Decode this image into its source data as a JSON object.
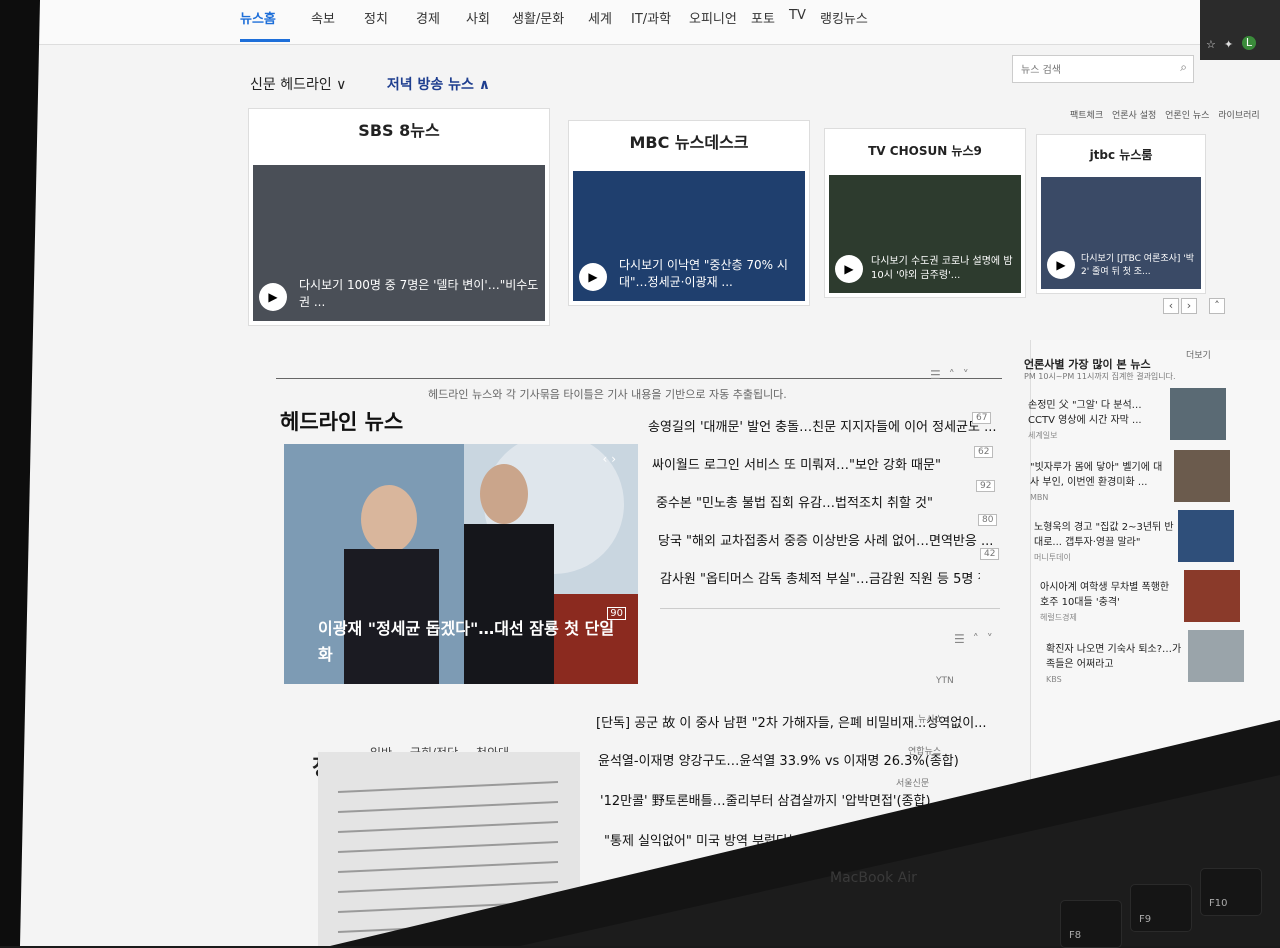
{
  "nav": {
    "items": [
      "뉴스홈",
      "속보",
      "정치",
      "경제",
      "사회",
      "생활/문화",
      "세계",
      "IT/과학",
      "오피니언",
      "포토",
      "TV",
      "랭킹뉴스"
    ]
  },
  "search": {
    "placeholder": "뉴스 검색"
  },
  "subtabs": {
    "newspaper": "신문 헤드라인 ∨",
    "evening": "저녁 방송 뉴스 ∧"
  },
  "util": [
    "팩트체크",
    "언론사 설정",
    "언론인 뉴스",
    "라이브러리"
  ],
  "broadcast": [
    {
      "logo": "SBS 8뉴스",
      "caption": "다시보기 100명 중 7명은 '델타 변이'…\"비수도권 ...",
      "color": "#4a4f57"
    },
    {
      "logo": "MBC 뉴스데스크",
      "caption": "다시보기 이낙연 \"중산층 70% 시대\"…정세균·이광재 ...",
      "color": "#1f3f6e"
    },
    {
      "logo": "TV CHOSUN 뉴스9",
      "caption": "다시보기 수도권 코로나 설명에 밤10시 '야외 금주령'...",
      "color": "#2d3b2e"
    },
    {
      "logo": "jtbc 뉴스룸",
      "caption": "다시보기 [JTBC 여론조사] '박2' 줄여 뒤 첫 조...",
      "color": "#3a4a66"
    }
  ],
  "headline": {
    "title": "헤드라인 뉴스",
    "note": "헤드라인 뉴스와 각 기사묶음 타이틀은 기사 내용을 기반으로 자동 추출됩니다.",
    "main_caption": "이광재 \"정세균 돕겠다\"…대선 잠룡 첫 단일화",
    "main_count": "90",
    "items": [
      {
        "text": "송영길의 '대깨문' 발언 충돌…친문 지지자들에 이어 정세균도 ...",
        "count": "67"
      },
      {
        "text": "싸이월드 로그인 서비스 또 미뤄져…\"보안 강화 때문\"",
        "count": "62"
      },
      {
        "text": "중수본 \"민노총 불법 집회 유감…법적조치 취할 것\"",
        "count": "92"
      },
      {
        "text": "당국 \"해외 교차접종서 중증 이상반응 사례 없어…면역반응 ...",
        "count": "80"
      },
      {
        "text": "감사원 \"옵티머스 감독 총체적 부실\"…금감원 직원 등 5명 징...",
        "count": "42"
      }
    ]
  },
  "side": {
    "title": "언론사별 가장 많이 본 뉴스",
    "sub": "PM 10시~PM 11시까지 집계한 결과입니다.",
    "more": "더보기",
    "items": [
      {
        "text": "손정민 父 \"그알' 다 분석… CCTV 영상에 시간 자막 ...",
        "src": "세계일보"
      },
      {
        "text": "\"빗자루가 몸에 닿아\" 벨기에 대사 부인, 이번엔 환경미화 ...",
        "src": "MBN"
      },
      {
        "text": "노형욱의 경고 \"집값 2~3년뒤 반대로... 갭투자·영끌 말라\"",
        "src": "머니투데이"
      },
      {
        "text": "아시아계 여학생 무차별 폭행한 호주 10대들 '충격'",
        "src": "헤럴드경제"
      },
      {
        "text": "확진자 나오면 기숙사 퇴소?…가족들은 어쩌라고",
        "src": "KBS"
      }
    ]
  },
  "politics": {
    "title": "정치",
    "tabs": [
      "일반",
      "국회/정당",
      "청와대"
    ],
    "items": [
      {
        "text": "[단독] 공군 故 이 중사 남편 \"2차 가해자들, 은폐 비밀비재...성역없이...",
        "src": "YTN"
      },
      {
        "text": "윤석열-이재명 양강구도…윤석열 33.9% vs 이재명 26.3%(종합)",
        "src": "뉴시스"
      },
      {
        "text": "'12만콜' 野토론배틀…줄리부터 삼겹살까지 '압박면접'(종합)",
        "src": "연합뉴스"
      },
      {
        "text": "'12만콜' 野토론배틀…줄리부터 삼겹살까지 '압박면접'(종합)",
        "src": "서울신문"
      },
      {
        "text": "\"통제 실익없어\" 미국 방역 부럽다는 홍정욱에 비난 빗발",
        "src": ""
      },
      {
        "text": "\"통제 실익없어\" 미국 방역 부럽다는 홍정욱에 비난 빗발",
        "src": ""
      }
    ]
  },
  "device": {
    "label": "MacBook Air"
  }
}
